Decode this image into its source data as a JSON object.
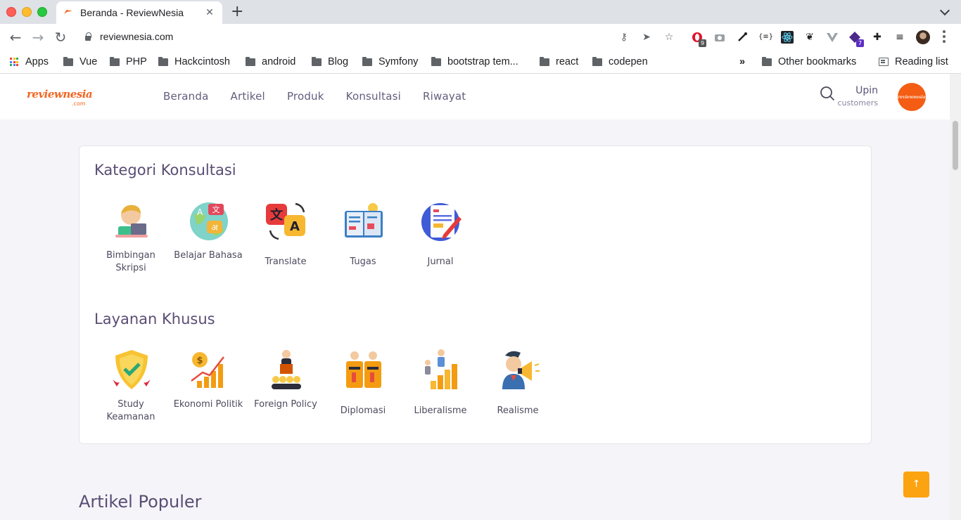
{
  "browser": {
    "tab_title": "Beranda - ReviewNesia",
    "url": "reviewnesia.com",
    "ext_badges": {
      "opera": "9",
      "purple": "7"
    },
    "bookmarks": [
      "Apps",
      "Vue",
      "PHP",
      "Hackcintosh",
      "android",
      "Blog",
      "Symfony",
      "bootstrap tem...",
      "react",
      "codepen"
    ],
    "overflow": "»",
    "other_bookmarks": "Other bookmarks",
    "reading_list": "Reading list"
  },
  "site": {
    "logo_text": "reviewnesia",
    "logo_sub": ".com",
    "nav": [
      "Beranda",
      "Artikel",
      "Produk",
      "Konsultasi",
      "Riwayat"
    ],
    "user": {
      "name": "Upin",
      "role": "customers"
    }
  },
  "consult": {
    "title": "Kategori Konsultasi",
    "items": [
      {
        "label": "Bimbingan Skripsi",
        "icon": "thesis-student-icon"
      },
      {
        "label": "Belajar Bahasa",
        "icon": "language-globe-icon"
      },
      {
        "label": "Translate",
        "icon": "translate-icon"
      },
      {
        "label": "Tugas",
        "icon": "assignment-book-icon"
      },
      {
        "label": "Jurnal",
        "icon": "journal-pencil-icon"
      }
    ]
  },
  "special": {
    "title": "Layanan Khusus",
    "items": [
      {
        "label": "Study Keamanan",
        "icon": "security-shield-icon"
      },
      {
        "label": "Ekonomi Politik",
        "icon": "economy-chart-icon"
      },
      {
        "label": "Foreign Policy",
        "icon": "foreign-policy-icon"
      },
      {
        "label": "Diplomasi",
        "icon": "diplomacy-podium-icon"
      },
      {
        "label": "Liberalisme",
        "icon": "liberalism-people-icon"
      },
      {
        "label": "Realisme",
        "icon": "realism-megaphone-icon"
      }
    ]
  },
  "popular": {
    "title": "Artikel Populer"
  },
  "colors": {
    "accent": "#f26522",
    "scroll_top": "#fca311",
    "heading": "#5a4d74"
  }
}
